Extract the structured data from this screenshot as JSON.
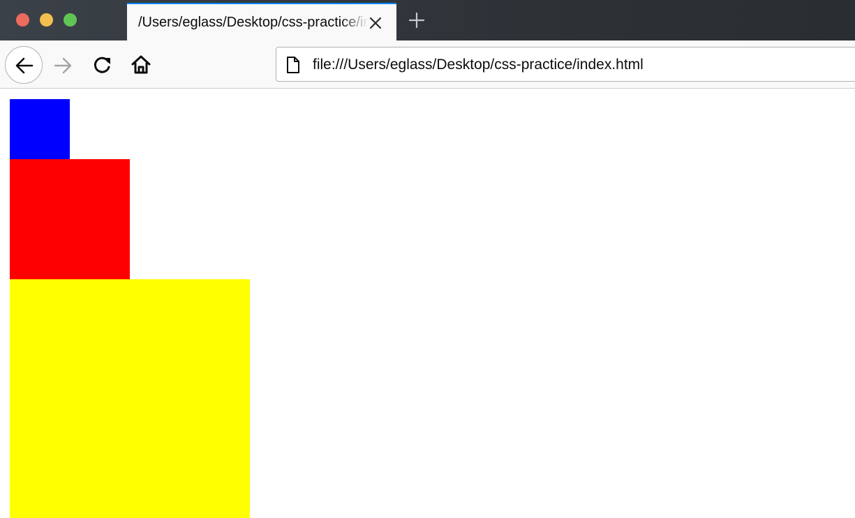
{
  "browser": {
    "tab": {
      "title": "/Users/eglass/Desktop/css-practice/index.html",
      "close_icon": "close-icon",
      "active_color": "#0a84ff"
    },
    "new_tab_icon": "plus-icon",
    "window_controls": {
      "close_color": "#ed6a5e",
      "minimize_color": "#f5bf4f",
      "zoom_color": "#61c554"
    },
    "nav": {
      "back_icon": "arrow-left-icon",
      "forward_icon": "arrow-right-icon",
      "reload_icon": "reload-icon",
      "home_icon": "home-icon"
    },
    "urlbar": {
      "page_icon": "page-icon",
      "url": "file:///Users/eglass/Desktop/css-practice/index.html"
    }
  },
  "page": {
    "boxes": [
      {
        "name": "blue",
        "color": "#0000ff"
      },
      {
        "name": "red",
        "color": "#ff0000"
      },
      {
        "name": "yellow",
        "color": "#ffff00"
      }
    ]
  }
}
